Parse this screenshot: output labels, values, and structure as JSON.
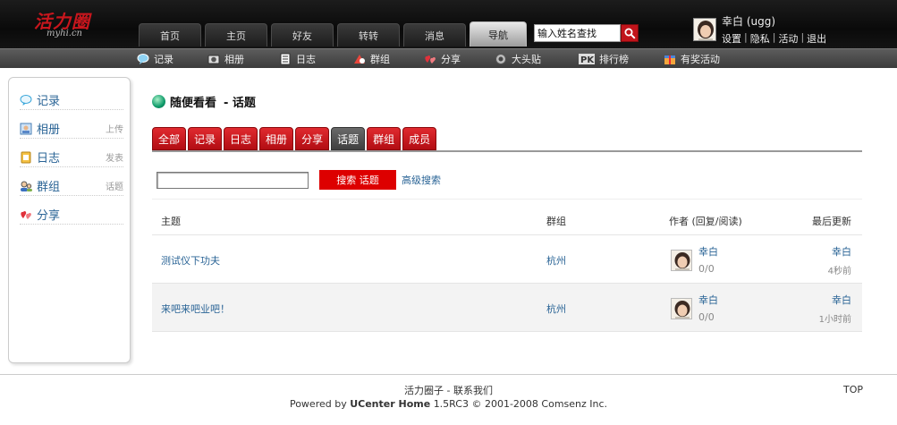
{
  "logo": {
    "text_cn": "活力圈",
    "text_en": "myhi.cn"
  },
  "main_nav": {
    "items": [
      {
        "label": "首页"
      },
      {
        "label": "主页"
      },
      {
        "label": "好友"
      },
      {
        "label": "转转"
      },
      {
        "label": "消息"
      },
      {
        "label": "导航",
        "active": true
      }
    ]
  },
  "header_search": {
    "value": "输入姓名查找"
  },
  "user": {
    "name": "幸白 (ugg)",
    "links": [
      "设置",
      "隐私",
      "活动",
      "退出"
    ]
  },
  "subnav": {
    "items": [
      {
        "label": "记录",
        "icon": "chat-bubble-icon"
      },
      {
        "label": "相册",
        "icon": "camera-icon"
      },
      {
        "label": "日志",
        "icon": "document-icon"
      },
      {
        "label": "群组",
        "icon": "group-icon"
      },
      {
        "label": "分享",
        "icon": "hearts-icon"
      },
      {
        "label": "大头贴",
        "icon": "photo-booth-icon"
      },
      {
        "label": "排行榜",
        "icon": "pk-icon"
      },
      {
        "label": "有奖活动",
        "icon": "prize-icon"
      }
    ]
  },
  "sidebar": {
    "items": [
      {
        "label": "记录",
        "extra": "",
        "icon": "chat-bubble-icon"
      },
      {
        "label": "相册",
        "extra": "上传",
        "icon": "album-icon"
      },
      {
        "label": "日志",
        "extra": "发表",
        "icon": "notebook-icon"
      },
      {
        "label": "群组",
        "extra": "话题",
        "icon": "group-icon"
      },
      {
        "label": "分享",
        "extra": "",
        "icon": "hearts-icon"
      }
    ]
  },
  "page": {
    "title": "随便看看",
    "subtitle": "- 话题"
  },
  "tabs": {
    "items": [
      {
        "label": "全部"
      },
      {
        "label": "记录"
      },
      {
        "label": "日志"
      },
      {
        "label": "相册"
      },
      {
        "label": "分享"
      },
      {
        "label": "话题",
        "active": true
      },
      {
        "label": "群组"
      },
      {
        "label": "成员"
      }
    ]
  },
  "topic_search": {
    "value": "",
    "button_label": "搜索 话题",
    "advanced_label": "高级搜索"
  },
  "table": {
    "headers": {
      "subject": "主题",
      "group": "群组",
      "author": "作者 (回复/阅读)",
      "last": "最后更新"
    },
    "rows": [
      {
        "subject": "测试仪下功夫",
        "group": "杭州",
        "author": "幸白",
        "counts": "0/0",
        "last_user": "幸白",
        "last_time": "4秒前"
      },
      {
        "subject": "来吧来吧业吧！",
        "group": "杭州",
        "author": "幸白",
        "counts": "0/0",
        "last_user": "幸白",
        "last_time": "1小时前"
      }
    ]
  },
  "footer": {
    "site_name": "活力圈子",
    "contact": "联系我们",
    "top": "TOP",
    "powered_prefix": "Powered by",
    "powered_brand": "UCenter Home",
    "powered_suffix": "1.5RC3 © 2001-2008 Comsenz Inc."
  },
  "colors": {
    "accent_red": "#c8161d",
    "tab_red": "#c9171d",
    "link_blue": "#2a6496",
    "header_bg": "#111111"
  }
}
